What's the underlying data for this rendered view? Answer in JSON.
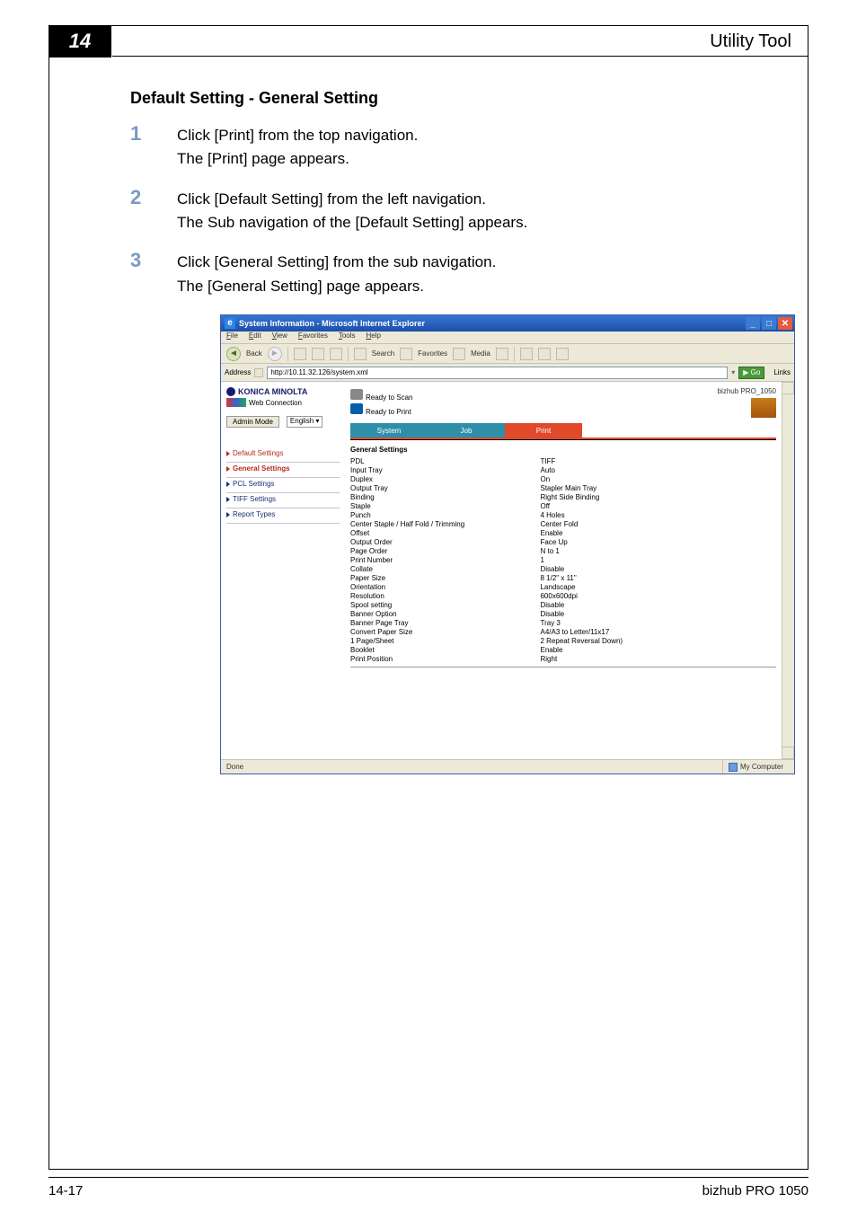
{
  "chapterTab": "14",
  "headline": "Utility Tool",
  "subhead": "Default Setting - General Setting",
  "steps": [
    {
      "num": "1",
      "lines": [
        "Click [Print] from the top navigation.",
        "The [Print] page appears."
      ]
    },
    {
      "num": "2",
      "lines": [
        "Click [Default Setting] from the left navigation.",
        "The Sub navigation of the [Default Setting] appears."
      ]
    },
    {
      "num": "3",
      "lines": [
        "Click [General Setting] from the sub navigation.",
        "The [General Setting] page appears."
      ]
    }
  ],
  "browser": {
    "title": "System Information - Microsoft Internet Explorer",
    "menus": [
      "File",
      "Edit",
      "View",
      "Favorites",
      "Tools",
      "Help"
    ],
    "toolbar": {
      "back": "Back",
      "search": "Search",
      "favorites": "Favorites",
      "media": "Media"
    },
    "addressLabel": "Address",
    "addressValue": "http://10.11.32.126/system.xml",
    "goLabel": "Go",
    "linksLabel": "Links",
    "statusbar": {
      "left": "Done",
      "zone": "My Computer"
    }
  },
  "app": {
    "brand": "KONICA MINOLTA",
    "connection": "Web Connection",
    "statuses": [
      {
        "icon": "scan",
        "text": "Ready to Scan"
      },
      {
        "icon": "printer",
        "text": "Ready to Print"
      }
    ],
    "modelName": "bizhub PRO_1050",
    "modeButton": "Admin Mode",
    "languageSelect": "English",
    "tabs": [
      "System",
      "Job",
      "Print"
    ],
    "tabActiveIndex": 2,
    "leftNav": [
      {
        "label": "Default Settings",
        "type": "redHeader"
      },
      {
        "label": "General Settings",
        "type": "redActive"
      },
      {
        "label": "PCL Settings",
        "type": "link"
      },
      {
        "label": "TIFF Settings",
        "type": "link"
      },
      {
        "label": "Report Types",
        "type": "link"
      }
    ],
    "settingsHeader": "General Settings",
    "settings": [
      {
        "k": "PDL",
        "v": "TIFF"
      },
      {
        "k": "Input Tray",
        "v": "Auto"
      },
      {
        "k": "Duplex",
        "v": "On"
      },
      {
        "k": "Output Tray",
        "v": "Stapler Main Tray"
      },
      {
        "k": "Binding",
        "v": "Right Side Binding"
      },
      {
        "k": "Staple",
        "v": "Off"
      },
      {
        "k": "Punch",
        "v": "4 Holes"
      },
      {
        "k": "Center Staple / Half Fold / Trimming",
        "v": "Center Fold"
      },
      {
        "k": "Offset",
        "v": "Enable"
      },
      {
        "k": "Output Order",
        "v": "Face Up"
      },
      {
        "k": "Page Order",
        "v": "N to 1"
      },
      {
        "k": "Print Number",
        "v": "1"
      },
      {
        "k": "Collate",
        "v": "Disable"
      },
      {
        "k": "Paper Size",
        "v": "8 1/2\" x 11\""
      },
      {
        "k": "Orientation",
        "v": "Landscape"
      },
      {
        "k": "Resolution",
        "v": "600x600dpi"
      },
      {
        "k": "Spool setting",
        "v": "Disable"
      },
      {
        "k": "Banner Option",
        "v": "Disable"
      },
      {
        "k": "Banner Page Tray",
        "v": "Tray 3"
      },
      {
        "k": "Convert Paper Size",
        "v": "A4/A3 to Letter/11x17"
      },
      {
        "k": "1 Page/Sheet",
        "v": "2 Repeat Reversal Down)"
      },
      {
        "k": "Booklet",
        "v": "Enable"
      },
      {
        "k": "Print Position",
        "v": "Right"
      }
    ]
  },
  "footer": {
    "left": "14-17",
    "right": "bizhub PRO 1050"
  }
}
